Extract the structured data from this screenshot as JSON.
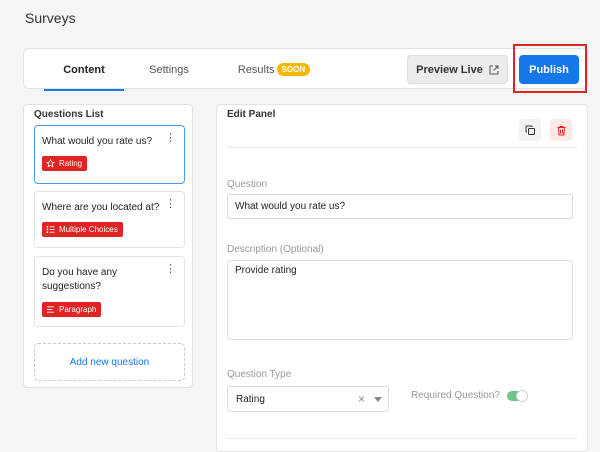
{
  "page": {
    "title": "Surveys"
  },
  "tabs": {
    "content": "Content",
    "settings": "Settings",
    "results": "Results",
    "results_badge": "SOON"
  },
  "actions": {
    "preview_live": "Preview Live",
    "publish": "Publish"
  },
  "questions_list": {
    "title": "Questions List",
    "items": [
      {
        "text": "What would you rate us?",
        "type": "Rating",
        "icon": "star-icon",
        "selected": true
      },
      {
        "text": "Where are you located at?",
        "type": "Multiple Choices",
        "icon": "list-icon",
        "selected": false
      },
      {
        "text": "Do you have any suggestions?",
        "type": "Paragraph",
        "icon": "paragraph-icon",
        "selected": false
      }
    ],
    "add_label": "Add new question"
  },
  "edit_panel": {
    "title": "Edit Panel",
    "question_label": "Question",
    "question_value": "What would you rate us?",
    "description_label": "Description (Optional)",
    "description_value": "Provide rating",
    "question_type_label": "Question Type",
    "question_type_value": "Rating",
    "required_label": "Required Question?",
    "required_on": true
  },
  "colors": {
    "primary": "#1677e8",
    "tag_red": "#e02424",
    "badge_yellow": "#f5b800",
    "toggle_green": "#6cc48a"
  }
}
